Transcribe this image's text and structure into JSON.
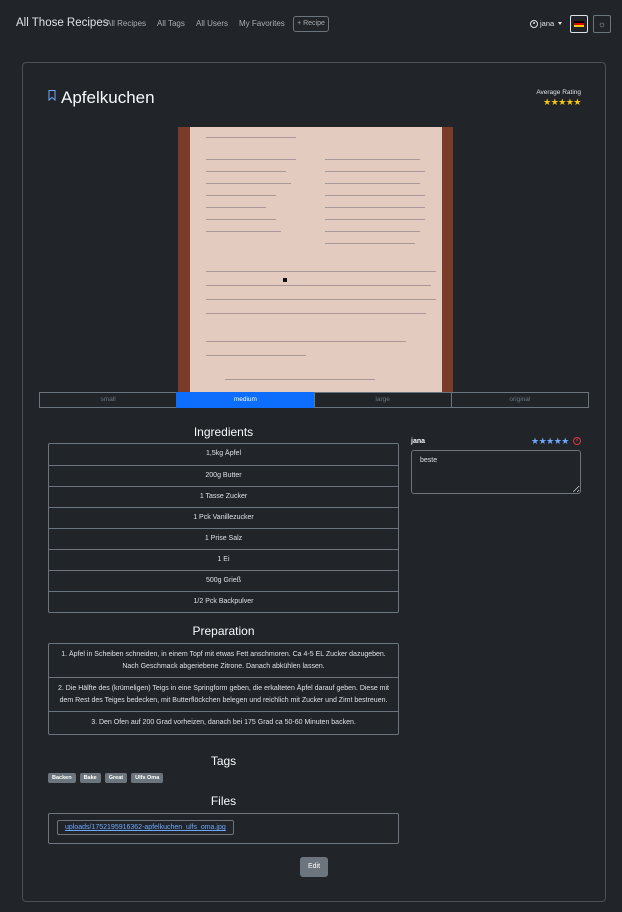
{
  "nav": {
    "brand": "All Those Recipes",
    "links": [
      "All Recipes",
      "All Tags",
      "All Users",
      "My Favorites"
    ],
    "add_recipe": "+ Recipe",
    "username": "jana",
    "icons": [
      "user-icon",
      "german-flag-icon",
      "theme-toggle-icon"
    ]
  },
  "recipe": {
    "title": "Apfelkuchen",
    "average_rating_label": "Average Rating",
    "average_rating_stars": "★★★★★",
    "image_sizes": [
      "small",
      "medium",
      "large",
      "original"
    ],
    "selected_size": "medium"
  },
  "ingredients": {
    "heading": "Ingredients",
    "items": [
      "1,5kg Äpfel",
      "200g Butter",
      "1 Tasse Zucker",
      "1 Pck Vanillezucker",
      "1 Prise Salz",
      "1 Ei",
      "500g Grieß",
      "1/2 Pck Backpulver"
    ]
  },
  "preparation": {
    "heading": "Preparation",
    "steps": [
      "1. Äpfel in Scheiben schneiden, in einem Topf mit etwas Fett anschmoren. Ca 4-5 EL Zucker dazugeben. Nach Geschmack abgeriebene Zitrone. Danach abkühlen lassen.",
      "2. Die Hälfte des (krümeligen) Teigs in eine Springform geben, die erkalteten Äpfel darauf geben. Diese mit dem Rest des Teiges bedecken, mit Butterflöckchen belegen und reichlich mit Zucker und Zimt bestreuen.",
      "3. Den Ofen auf 200 Grad vorheizen, danach bei 175 Grad ca 50-60 Minuten backen."
    ]
  },
  "tags": {
    "heading": "Tags",
    "items": [
      "Backen",
      "Bake",
      "Great",
      "Ulfs Oma"
    ]
  },
  "files": {
    "heading": "Files",
    "link": "uploads/1752195916362-apfelkuchen_ulfs_oma.jpg"
  },
  "edit_label": "Edit",
  "comment": {
    "author": "jana",
    "stars": "★★★★★",
    "text": "beste"
  },
  "colors": {
    "background": "#212529",
    "accent": "#0d6efd",
    "star_gold": "#f5c518",
    "star_blue": "#6ea8fe",
    "danger": "#dc3545"
  }
}
